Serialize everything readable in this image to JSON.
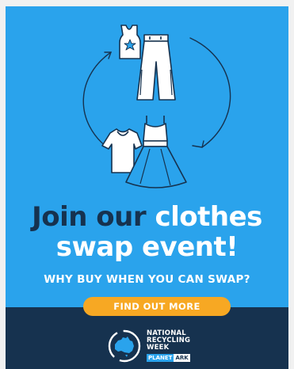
{
  "headline": {
    "part1": "Join our ",
    "part2": "clothes",
    "part3": "swap event!"
  },
  "subheadline": "WHY BUY WHEN YOU CAN SWAP?",
  "cta": {
    "label": "FIND OUT MORE"
  },
  "logo": {
    "line1": "NATIONAL",
    "line2": "RECYCLING",
    "line3": "WEEK",
    "badge_part1": "PLANET",
    "badge_part2": "ARK"
  },
  "colors": {
    "background": "#2aa3ec",
    "navy": "#16324f",
    "accent": "#f7a823",
    "white": "#ffffff"
  },
  "icons": [
    "tank-top-icon",
    "trousers-icon",
    "t-shirt-icon",
    "dress-icon",
    "recycle-arrows-icon",
    "australia-map-icon"
  ]
}
